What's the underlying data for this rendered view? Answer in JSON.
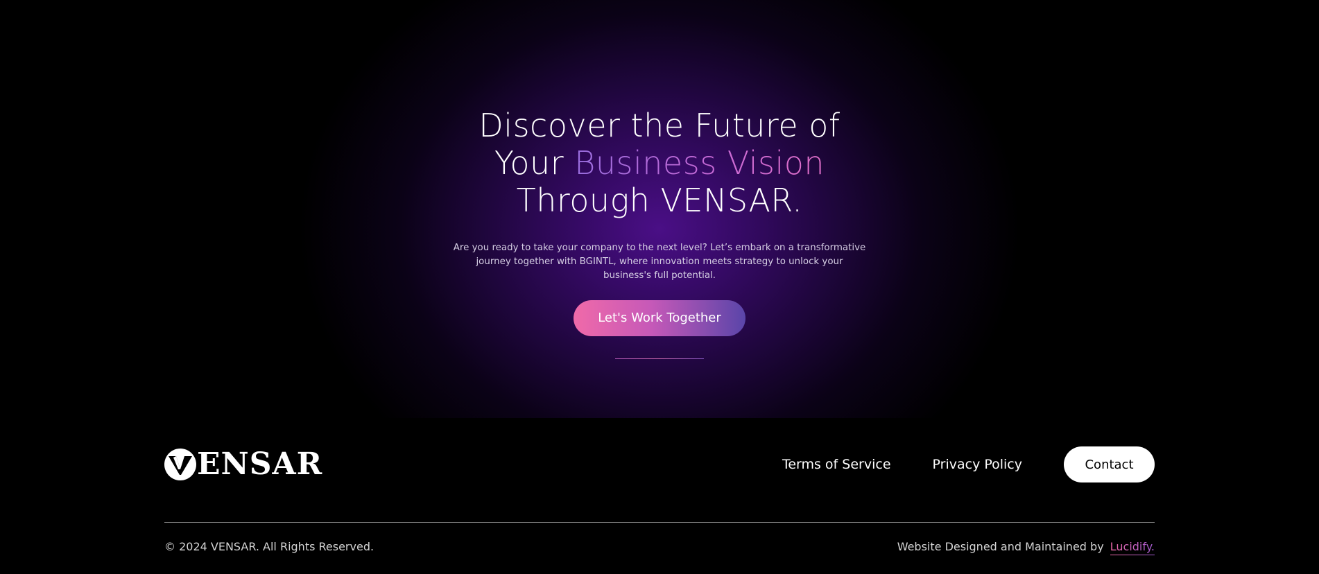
{
  "hero": {
    "headline_line1": "Discover the Future of",
    "headline_line2_prefix": "Your ",
    "headline_line2_highlight": "Business Vision",
    "headline_line3": "Through VENSAR.",
    "subtext": "Are you ready to take your company to the next level? Let’s embark on a transformative journey together with BGINTL, where innovation meets strategy to unlock your business's full potential.",
    "cta_label": "Let's Work Together"
  },
  "footer": {
    "logo_text": "ENSAR",
    "nav": {
      "terms": "Terms of Service",
      "privacy": "Privacy Policy",
      "contact": "Contact"
    },
    "copyright": "© 2024 VENSAR. All Rights Reserved.",
    "credit_prefix": "Website Designed and Maintained by",
    "credit_link": "Lucidify."
  },
  "colors": {
    "background": "#000000",
    "hero_glow": "#4a0f86",
    "highlight_start": "#9a6fe0",
    "highlight_end": "#e06fc8",
    "cta_start": "#f06aa9",
    "cta_end": "#5a45a9"
  },
  "icons": {
    "logo_mark": "vensar-v-logo-icon"
  }
}
